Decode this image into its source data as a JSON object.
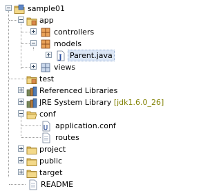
{
  "tree": {
    "items": [
      {
        "label": "sample01",
        "icon": "project-icon",
        "expanded": true
      },
      {
        "label": "app",
        "icon": "source-folder-icon",
        "expanded": true
      },
      {
        "label": "controllers",
        "icon": "package-icon",
        "expanded": false
      },
      {
        "label": "models",
        "icon": "package-icon",
        "expanded": true
      },
      {
        "label": "Parent.java",
        "icon": "java-file-icon",
        "expanded": false,
        "selected": true
      },
      {
        "label": "views",
        "icon": "package-icon",
        "expanded": false
      },
      {
        "label": "test",
        "icon": "source-folder-icon"
      },
      {
        "label": "Referenced Libraries",
        "icon": "library-icon",
        "expanded": false
      },
      {
        "label": "JRE System Library",
        "decoration": "[jdk1.6.0_26]",
        "icon": "library-icon",
        "expanded": false
      },
      {
        "label": "conf",
        "icon": "folder-icon",
        "expanded": true
      },
      {
        "label": "application.conf",
        "icon": "file-icon"
      },
      {
        "label": "routes",
        "icon": "file-icon"
      },
      {
        "label": "project",
        "icon": "folder-icon",
        "expanded": false
      },
      {
        "label": "public",
        "icon": "folder-icon",
        "expanded": false
      },
      {
        "label": "target",
        "icon": "folder-icon",
        "expanded": false
      },
      {
        "label": "README",
        "icon": "file-icon"
      }
    ]
  }
}
